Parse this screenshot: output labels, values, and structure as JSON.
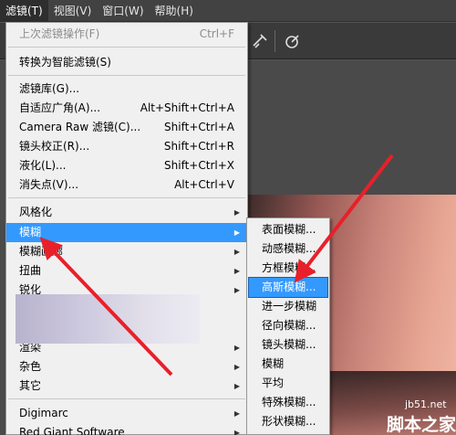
{
  "menubar": {
    "items": [
      {
        "label": "滤镜(T)",
        "active": true
      },
      {
        "label": "视图(V)",
        "active": false
      },
      {
        "label": "窗口(W)",
        "active": false
      },
      {
        "label": "帮助(H)",
        "active": false
      }
    ]
  },
  "filter_menu": {
    "items": [
      {
        "label": "上次滤镜操作(F)",
        "shortcut": "Ctrl+F",
        "disabled": true
      },
      {
        "label": "转换为智能滤镜(S)",
        "shortcut": ""
      },
      {
        "label": "滤镜库(G)...",
        "shortcut": ""
      },
      {
        "label": "自适应广角(A)...",
        "shortcut": "Alt+Shift+Ctrl+A"
      },
      {
        "label": "Camera Raw 滤镜(C)...",
        "shortcut": "Shift+Ctrl+A"
      },
      {
        "label": "镜头校正(R)...",
        "shortcut": "Shift+Ctrl+R"
      },
      {
        "label": "液化(L)...",
        "shortcut": "Shift+Ctrl+X"
      },
      {
        "label": "消失点(V)...",
        "shortcut": "Alt+Ctrl+V"
      },
      {
        "label": "风格化",
        "submenu": true
      },
      {
        "label": "模糊",
        "submenu": true,
        "highlighted": true
      },
      {
        "label": "模糊画廊",
        "submenu": true
      },
      {
        "label": "扭曲",
        "submenu": true
      },
      {
        "label": "锐化",
        "submenu": true
      },
      {
        "label": "渲染",
        "submenu": true
      },
      {
        "label": "杂色",
        "submenu": true
      },
      {
        "label": "其它",
        "submenu": true
      },
      {
        "label": "Digimarc",
        "submenu": true
      },
      {
        "label": "Red Giant Software",
        "submenu": true
      }
    ]
  },
  "blur_submenu": {
    "items": [
      {
        "label": "表面模糊..."
      },
      {
        "label": "动感模糊..."
      },
      {
        "label": "方框模糊..."
      },
      {
        "label": "高斯模糊...",
        "selected": true
      },
      {
        "label": "进一步模糊"
      },
      {
        "label": "径向模糊..."
      },
      {
        "label": "镜头模糊..."
      },
      {
        "label": "模糊"
      },
      {
        "label": "平均"
      },
      {
        "label": "特殊模糊..."
      },
      {
        "label": "形状模糊..."
      }
    ]
  },
  "toolbar": {
    "icons": [
      "airbrush-icon",
      "target-icon"
    ]
  },
  "colors": {
    "highlight": "#3399ff",
    "arrow": "#e8202a"
  },
  "watermark": {
    "line1": "jb51.net",
    "line2": "脚本之家"
  }
}
